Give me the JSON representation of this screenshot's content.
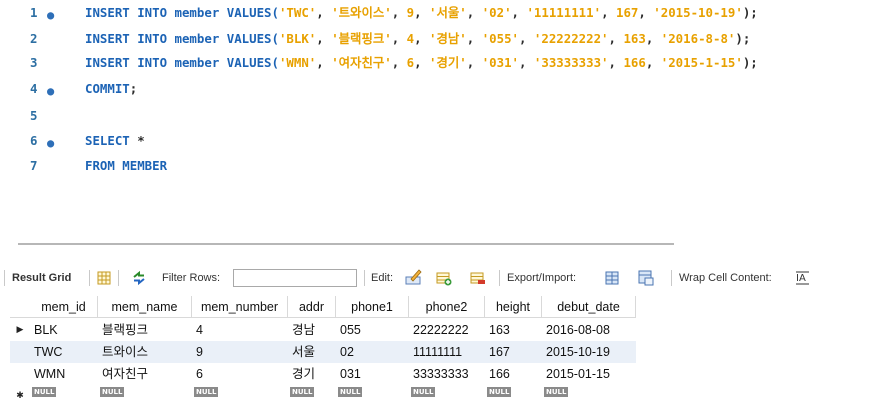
{
  "editor": {
    "lines": [
      {
        "num": "1",
        "dot": true,
        "tokens": [
          {
            "t": "INSERT INTO member VALUES(",
            "c": "kw"
          },
          {
            "t": "'TWC'",
            "c": "str"
          },
          {
            "t": ", ",
            "c": "punc"
          },
          {
            "t": "'트와이스'",
            "c": "str"
          },
          {
            "t": ", ",
            "c": "punc"
          },
          {
            "t": "9",
            "c": "num"
          },
          {
            "t": ", ",
            "c": "punc"
          },
          {
            "t": "'서울'",
            "c": "str"
          },
          {
            "t": ", ",
            "c": "punc"
          },
          {
            "t": "'02'",
            "c": "str"
          },
          {
            "t": ", ",
            "c": "punc"
          },
          {
            "t": "'11111111'",
            "c": "str"
          },
          {
            "t": ", ",
            "c": "punc"
          },
          {
            "t": "167",
            "c": "num"
          },
          {
            "t": ", ",
            "c": "punc"
          },
          {
            "t": "'2015-10-19'",
            "c": "str"
          },
          {
            "t": ");",
            "c": "punc"
          }
        ]
      },
      {
        "num": "2",
        "dot": false,
        "tokens": [
          {
            "t": "INSERT INTO member VALUES(",
            "c": "kw"
          },
          {
            "t": "'BLK'",
            "c": "str"
          },
          {
            "t": ", ",
            "c": "punc"
          },
          {
            "t": "'블랙핑크'",
            "c": "str"
          },
          {
            "t": ", ",
            "c": "punc"
          },
          {
            "t": "4",
            "c": "num"
          },
          {
            "t": ", ",
            "c": "punc"
          },
          {
            "t": "'경남'",
            "c": "str"
          },
          {
            "t": ", ",
            "c": "punc"
          },
          {
            "t": "'055'",
            "c": "str"
          },
          {
            "t": ", ",
            "c": "punc"
          },
          {
            "t": "'22222222'",
            "c": "str"
          },
          {
            "t": ", ",
            "c": "punc"
          },
          {
            "t": "163",
            "c": "num"
          },
          {
            "t": ", ",
            "c": "punc"
          },
          {
            "t": "'2016-8-8'",
            "c": "str"
          },
          {
            "t": ");",
            "c": "punc"
          }
        ]
      },
      {
        "num": "3",
        "dot": false,
        "tokens": [
          {
            "t": "INSERT INTO member VALUES(",
            "c": "kw"
          },
          {
            "t": "'WMN'",
            "c": "str"
          },
          {
            "t": ", ",
            "c": "punc"
          },
          {
            "t": "'여자친구'",
            "c": "str"
          },
          {
            "t": ", ",
            "c": "punc"
          },
          {
            "t": "6",
            "c": "num"
          },
          {
            "t": ", ",
            "c": "punc"
          },
          {
            "t": "'경기'",
            "c": "str"
          },
          {
            "t": ", ",
            "c": "punc"
          },
          {
            "t": "'031'",
            "c": "str"
          },
          {
            "t": ", ",
            "c": "punc"
          },
          {
            "t": "'33333333'",
            "c": "str"
          },
          {
            "t": ", ",
            "c": "punc"
          },
          {
            "t": "166",
            "c": "num"
          },
          {
            "t": ", ",
            "c": "punc"
          },
          {
            "t": "'2015-1-15'",
            "c": "str"
          },
          {
            "t": ");",
            "c": "punc"
          }
        ]
      },
      {
        "num": "4",
        "dot": true,
        "tokens": [
          {
            "t": "COMMIT",
            "c": "kw"
          },
          {
            "t": ";",
            "c": "punc"
          }
        ]
      },
      {
        "num": "5",
        "dot": false,
        "tokens": []
      },
      {
        "num": "6",
        "dot": true,
        "tokens": [
          {
            "t": "SELECT",
            "c": "kw"
          },
          {
            "t": " *",
            "c": "punc"
          }
        ]
      },
      {
        "num": "7",
        "dot": false,
        "tokens": [
          {
            "t": "FROM MEMBER",
            "c": "kw"
          }
        ]
      }
    ]
  },
  "toolbar": {
    "result_grid": "Result Grid",
    "filter_rows": "Filter Rows:",
    "filter_value": "",
    "edit": "Edit:",
    "export_import": "Export/Import:",
    "wrap": "Wrap Cell Content:"
  },
  "icons": {
    "grid": "grid-view-icon",
    "refresh": "refresh-arrows-icon",
    "edit_pencil": "edit-row-icon",
    "add_row": "add-row-icon",
    "delete_row": "delete-row-icon",
    "export": "export-icon",
    "import": "import-icon",
    "wrap": "wrap-cell-icon"
  },
  "colors": {
    "keyword": "#1c63b5",
    "string": "#e8a100",
    "line_number": "#2d6fa3",
    "alt_row": "#eaf0f8",
    "null_badge": "#8a8a8a"
  },
  "grid": {
    "columns": [
      "mem_id",
      "mem_name",
      "mem_number",
      "addr",
      "phone1",
      "phone2",
      "height",
      "debut_date"
    ],
    "rows": [
      [
        "BLK",
        "블랙핑크",
        "4",
        "경남",
        "055",
        "22222222",
        "163",
        "2016-08-08"
      ],
      [
        "TWC",
        "트와이스",
        "9",
        "서울",
        "02",
        "11111111",
        "167",
        "2015-10-19"
      ],
      [
        "WMN",
        "여자친구",
        "6",
        "경기",
        "031",
        "33333333",
        "166",
        "2015-01-15"
      ]
    ],
    "new_row_label": "NULL",
    "current_row_marker": "▶",
    "new_row_marker": "✱"
  }
}
